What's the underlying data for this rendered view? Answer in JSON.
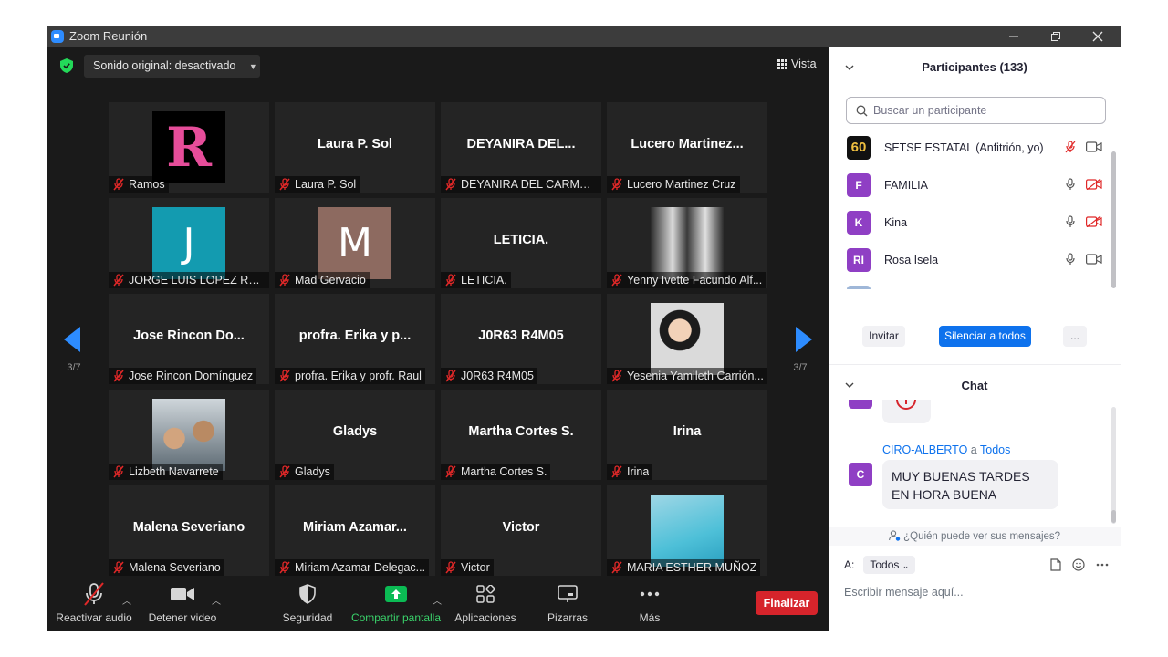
{
  "window": {
    "title": "Zoom Reunión"
  },
  "topbar": {
    "sound_label": "Sonido original: desactivado",
    "view_label": "Vista"
  },
  "pager": {
    "left": "3/7",
    "right": "3/7"
  },
  "tiles": [
    {
      "big": "",
      "tag": "Ramos",
      "avatar": "R"
    },
    {
      "big": "Laura P. Sol",
      "tag": "Laura P. Sol"
    },
    {
      "big": "DEYANIRA DEL...",
      "tag": "DEYANIRA DEL CARMEN..."
    },
    {
      "big": "Lucero  Martinez...",
      "tag": "Lucero Martinez Cruz"
    },
    {
      "big": "",
      "tag": "JORGE LUIS LOPEZ RAMIREZ",
      "avatar": "J"
    },
    {
      "big": "",
      "tag": "Mad Gervacio",
      "avatar": "M"
    },
    {
      "big": "LETICIA.",
      "tag": "LETICIA."
    },
    {
      "big": "",
      "tag": "Yenny Ivette Facundo Alf..."
    },
    {
      "big": "Jose  Rincon  Do...",
      "tag": "Jose Rincon Domínguez"
    },
    {
      "big": "profra.  Erika  y  p...",
      "tag": "profra. Erika y profr. Raul"
    },
    {
      "big": "J0R63  R4M05",
      "tag": "J0R63 R4M05"
    },
    {
      "big": "",
      "tag": "Yesenia Yamileth Carrión..."
    },
    {
      "big": "",
      "tag": "Lizbeth Navarrete"
    },
    {
      "big": "Gladys",
      "tag": "Gladys"
    },
    {
      "big": "Martha Cortes S.",
      "tag": "Martha Cortes S."
    },
    {
      "big": "Irina",
      "tag": "Irina"
    },
    {
      "big": "Malena Severiano",
      "tag": "Malena Severiano"
    },
    {
      "big": "Miriam  Azamar...",
      "tag": "Miriam Azamar Delegac..."
    },
    {
      "big": "Victor",
      "tag": "Victor"
    },
    {
      "big": "",
      "tag": "MARIA ESTHER MUÑOZ"
    }
  ],
  "toolbar": {
    "audio": "Reactivar audio",
    "video": "Detener video",
    "security": "Seguridad",
    "share": "Compartir pantalla",
    "apps": "Aplicaciones",
    "whiteboards": "Pizarras",
    "more": "Más",
    "end": "Finalizar"
  },
  "participants": {
    "title": "Participantes (133)",
    "search_placeholder": "Buscar un participante",
    "list": [
      {
        "initials": "60",
        "name": "SETSE ESTATAL (Anfitrión, yo)"
      },
      {
        "initials": "F",
        "name": "FAMILIA"
      },
      {
        "initials": "K",
        "name": "Kina"
      },
      {
        "initials": "RI",
        "name": "Rosa Isela"
      }
    ],
    "invite": "Invitar",
    "mute_all": "Silenciar a todos",
    "more": "..."
  },
  "chat": {
    "title": "Chat",
    "sender": "CIRO-ALBERTO",
    "to_word": "a",
    "to_target": "Todos",
    "sender_initial": "C",
    "message": "MUY BUENAS TARDES EN HORA BUENA",
    "who_can_see": "¿Quién puede ver sus mensajes?",
    "to_label": "A:",
    "to_select": "Todos",
    "input_placeholder": "Escribir mensaje aquí..."
  },
  "colors": {
    "accent_blue": "#0e72ed",
    "end_red": "#d6242b",
    "share_green": "#0bbb54",
    "mic_muted": "#e02828",
    "avatar_purple": "#8f3fc4"
  }
}
